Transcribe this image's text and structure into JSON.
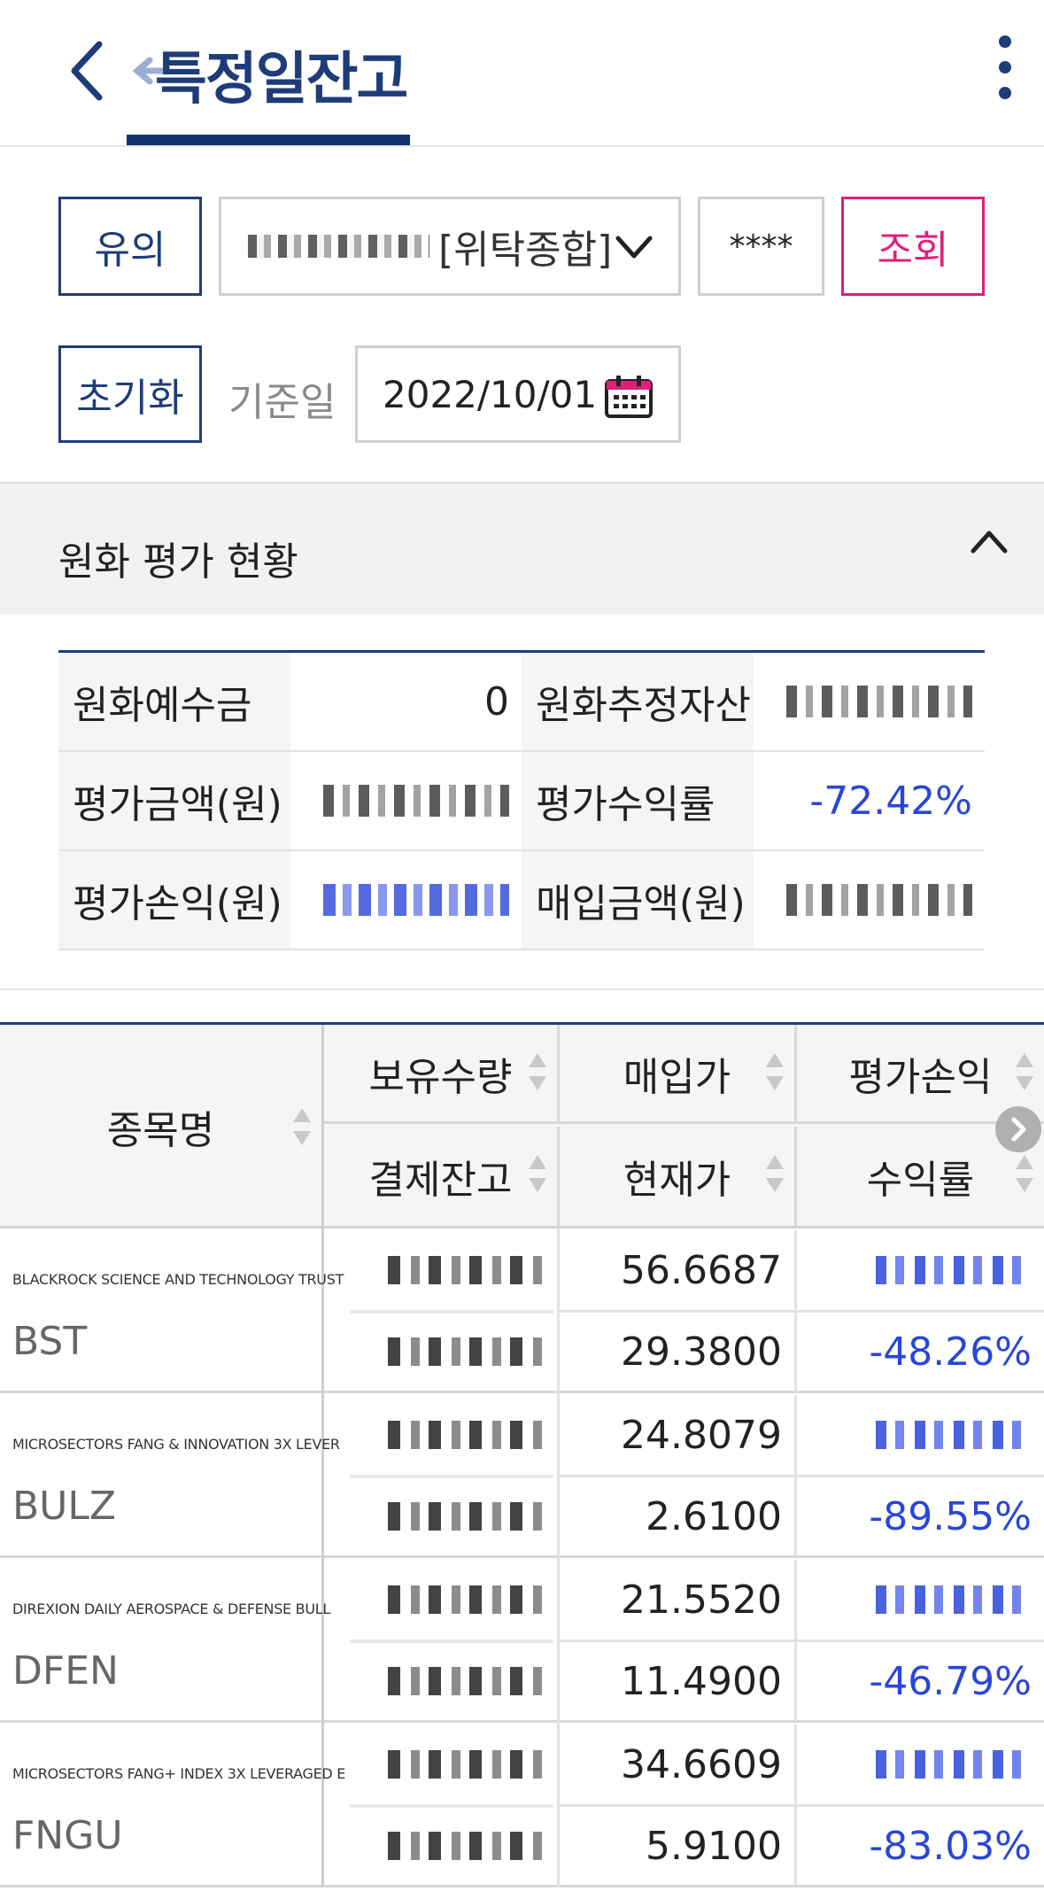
{
  "header": {
    "title": "특정일잔고"
  },
  "controls": {
    "notice_label": "유의",
    "account_type": "[위탁종합]",
    "password_mask": "****",
    "search_label": "조회",
    "reset_label": "초기화",
    "date_label": "기준일",
    "date_value": "2022/10/01"
  },
  "section": {
    "title": "원화 평가 현황"
  },
  "summary": {
    "rows": [
      {
        "l1": "원화예수금",
        "v1": "0",
        "l2": "원화추정자산"
      },
      {
        "l1": "평가금액(원)",
        "l2": "평가수익률",
        "v2": "-72.42%"
      },
      {
        "l1": "평가손익(원)",
        "l2": "매입금액(원)"
      }
    ]
  },
  "grid": {
    "headers": {
      "name": "종목명",
      "qty": "보유수량",
      "buy_price": "매입가",
      "pnl": "평가손익",
      "settle": "결제잔고",
      "cur_price": "현재가",
      "rate": "수익률"
    },
    "stocks": [
      {
        "full_name": "BLACKROCK SCIENCE AND TECHNOLOGY TRUST",
        "ticker": "BST",
        "buy_price": "56.6687",
        "cur_price": "29.3800",
        "rate": "-48.26%"
      },
      {
        "full_name": "MICROSECTORS FANG & INNOVATION 3X LEVER",
        "ticker": "BULZ",
        "buy_price": "24.8079",
        "cur_price": "2.6100",
        "rate": "-89.55%"
      },
      {
        "full_name": "DIREXION DAILY AEROSPACE & DEFENSE BULL",
        "ticker": "DFEN",
        "buy_price": "21.5520",
        "cur_price": "11.4900",
        "rate": "-46.79%"
      },
      {
        "full_name": "MICROSECTORS FANG+ INDEX 3X LEVERAGED E",
        "ticker": "FNGU",
        "buy_price": "34.6609",
        "cur_price": "5.9100",
        "rate": "-83.03%"
      }
    ]
  },
  "colors": {
    "brand_navy": "#1e3c78",
    "accent_pink": "#e01e7a",
    "negative_blue": "#2a46d8"
  },
  "icons": [
    "back-arrow-icon",
    "more-vertical-icon",
    "chevron-down-icon",
    "calendar-icon",
    "chevron-up-icon",
    "sort-icon",
    "scroll-right-icon"
  ]
}
